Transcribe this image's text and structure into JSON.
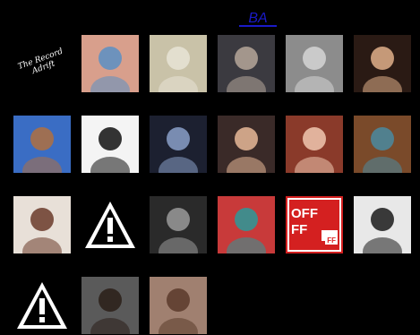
{
  "header": {
    "logo_label": "BA",
    "logo_color": "#1a1ac8"
  },
  "tiles": [
    {
      "name": "tile-script-logo",
      "kind": "text",
      "text": "The Record Adrift"
    },
    {
      "name": "tile-photo-pink-room",
      "kind": "photo",
      "bg": "#d89f8c",
      "accent": "#5a8fc4"
    },
    {
      "name": "tile-photo-white-gazebo",
      "kind": "photo",
      "bg": "#c9c2a8",
      "accent": "#e8e4d6"
    },
    {
      "name": "tile-photo-man-striped-shirt",
      "kind": "photo",
      "bg": "#3b3a40",
      "accent": "#b6a79a"
    },
    {
      "name": "tile-photo-foggy-sky",
      "kind": "photo",
      "bg": "#8c8c8c",
      "accent": "#d5d5d5"
    },
    {
      "name": "tile-photo-blonde-woman",
      "kind": "photo",
      "bg": "#2a1a14",
      "accent": "#e0b089"
    },
    {
      "name": "tile-photo-desert-figure",
      "kind": "photo",
      "bg": "#3a6dc4",
      "accent": "#b0703f"
    },
    {
      "name": "tile-photo-piano-keys",
      "kind": "photo",
      "bg": "#f4f4f4",
      "accent": "#111111"
    },
    {
      "name": "tile-photo-dark-geometric",
      "kind": "photo",
      "bg": "#1c2030",
      "accent": "#8aa0c8"
    },
    {
      "name": "tile-photo-smiling-woman",
      "kind": "photo",
      "bg": "#3a2a28",
      "accent": "#e8b898"
    },
    {
      "name": "tile-photo-red-haired-woman",
      "kind": "photo",
      "bg": "#8a3a2a",
      "accent": "#f0c8b0"
    },
    {
      "name": "tile-photo-teal-object",
      "kind": "photo",
      "bg": "#7a4a2a",
      "accent": "#4a8aa0"
    },
    {
      "name": "tile-photo-woman-headdress",
      "kind": "photo",
      "bg": "#e8e0d8",
      "accent": "#6a3a2a"
    },
    {
      "name": "tile-missing-image-warning",
      "kind": "warning"
    },
    {
      "name": "tile-photo-man-black-white",
      "kind": "photo",
      "bg": "#2a2a2a",
      "accent": "#9a9a9a"
    },
    {
      "name": "tile-colorful-illustration",
      "kind": "photo",
      "bg": "#c83a3a",
      "accent": "#2a9a9a"
    },
    {
      "name": "tile-off-ff-logo",
      "kind": "off",
      "text": "OFF",
      "text2": "FF",
      "sub": "FF"
    },
    {
      "name": "tile-photo-dark-haired-woman",
      "kind": "photo",
      "bg": "#e8e8e8",
      "accent": "#1a1a1a"
    },
    {
      "name": "tile-missing-image-warning-2",
      "kind": "warning"
    },
    {
      "name": "tile-photo-young-man",
      "kind": "photo",
      "bg": "#5a5a5a",
      "accent": "#2a1e18"
    },
    {
      "name": "tile-photo-bearded-man",
      "kind": "photo",
      "bg": "#a08070",
      "accent": "#5a3a2a"
    }
  ]
}
